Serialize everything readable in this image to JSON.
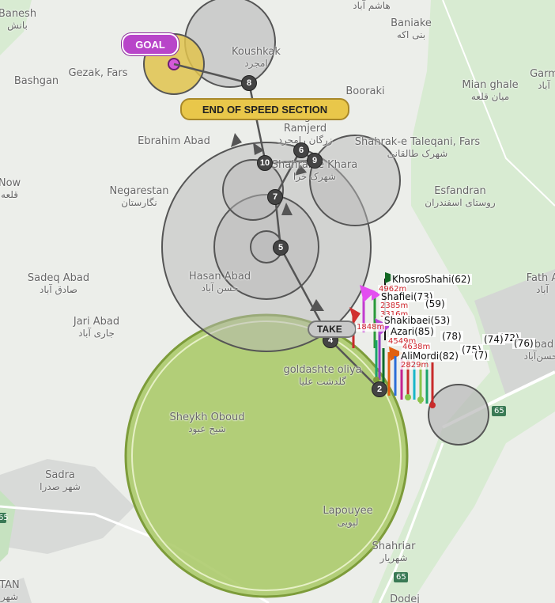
{
  "map": {
    "places": [
      {
        "en": "Banesh",
        "fa": "بانش"
      },
      {
        "en": "Bashgan",
        "fa": ""
      },
      {
        "en": "Gezak, Fars",
        "fa": ""
      },
      {
        "en": "Koushkak",
        "fa": "امجرد"
      },
      {
        "en": "",
        "fa": "هاشم آباد"
      },
      {
        "en": "Baniake",
        "fa": "بنی اکه"
      },
      {
        "en": "Booraki",
        "fa": ""
      },
      {
        "en": "Mian ghale",
        "fa": "میان قلعه"
      },
      {
        "en": "Garm",
        "fa": "آباد"
      },
      {
        "en": "Ebrahim Abad",
        "fa": ""
      },
      {
        "en": "Zargan",
        "fa": "زرگان"
      },
      {
        "en": "Ramjerd",
        "fa": "زرگان رامجرد"
      },
      {
        "en": "Shahrak-e Taleqani, Fars",
        "fa": "شهرک طالقانی"
      },
      {
        "en": "Now",
        "fa": "قلعه"
      },
      {
        "en": "Negarestan",
        "fa": "نگارستان"
      },
      {
        "en": "Shahrak-e Khara",
        "fa": "شهرک خرا"
      },
      {
        "en": "Esfandran",
        "fa": "روستای اسفندران"
      },
      {
        "en": "Sadeq Abad",
        "fa": "صادق آباد"
      },
      {
        "en": "Hasan Abad",
        "fa": "حسن آباد"
      },
      {
        "en": "Fath A",
        "fa": "آباد"
      },
      {
        "en": "Jari Abad",
        "fa": "جاری آباد"
      },
      {
        "en": "goldashte oliya",
        "fa": "گلدشت علیا"
      },
      {
        "en": "Sheykh Oboud",
        "fa": "شیخ عبود"
      },
      {
        "en": "Sadra",
        "fa": "شهر صدرا"
      },
      {
        "en": "Lapouyee",
        "fa": "لپویی"
      },
      {
        "en": "Shahriar",
        "fa": "شهریار"
      },
      {
        "en": "abad",
        "fa": "حسن‌آباد"
      },
      {
        "en": "Dodej",
        "fa": ""
      },
      {
        "en": "TAN",
        "fa": "شهر"
      }
    ],
    "roads": [
      "65",
      "65",
      "65"
    ],
    "waypoints": [
      "2",
      "4",
      "5",
      "6",
      "7",
      "8",
      "9",
      "10"
    ],
    "badges": {
      "goal": "GOAL",
      "ess": "END OF SPEED SECTION",
      "take": "TAKE"
    },
    "pilots": [
      {
        "label": "KhosroShahi(62)",
        "dist": "4962m"
      },
      {
        "label": "Shafiei(73)",
        "dist": "2385m"
      },
      {
        "label": "(59)",
        "dist": "3316m"
      },
      {
        "label": "Shakibaei(53)",
        "dist": "1848m"
      },
      {
        "label": "Azari(85)",
        "dist": "4549m"
      },
      {
        "label": "(78)",
        "dist": "4638m"
      },
      {
        "label": "AliMordi(82)",
        "dist": "2829m"
      },
      {
        "label": "(72)",
        "dist": ""
      },
      {
        "label": "(74)",
        "dist": ""
      },
      {
        "label": "(75)",
        "dist": ""
      },
      {
        "label": "(76)",
        "dist": ""
      },
      {
        "label": "(7)",
        "dist": ""
      }
    ],
    "colors": {
      "goal_cylinder": "#e1c34d",
      "start_cylinder": "#a8c864",
      "turnpoint": "#b0b0b0",
      "route": "#555555",
      "goal_badge": "#b845c9"
    }
  }
}
